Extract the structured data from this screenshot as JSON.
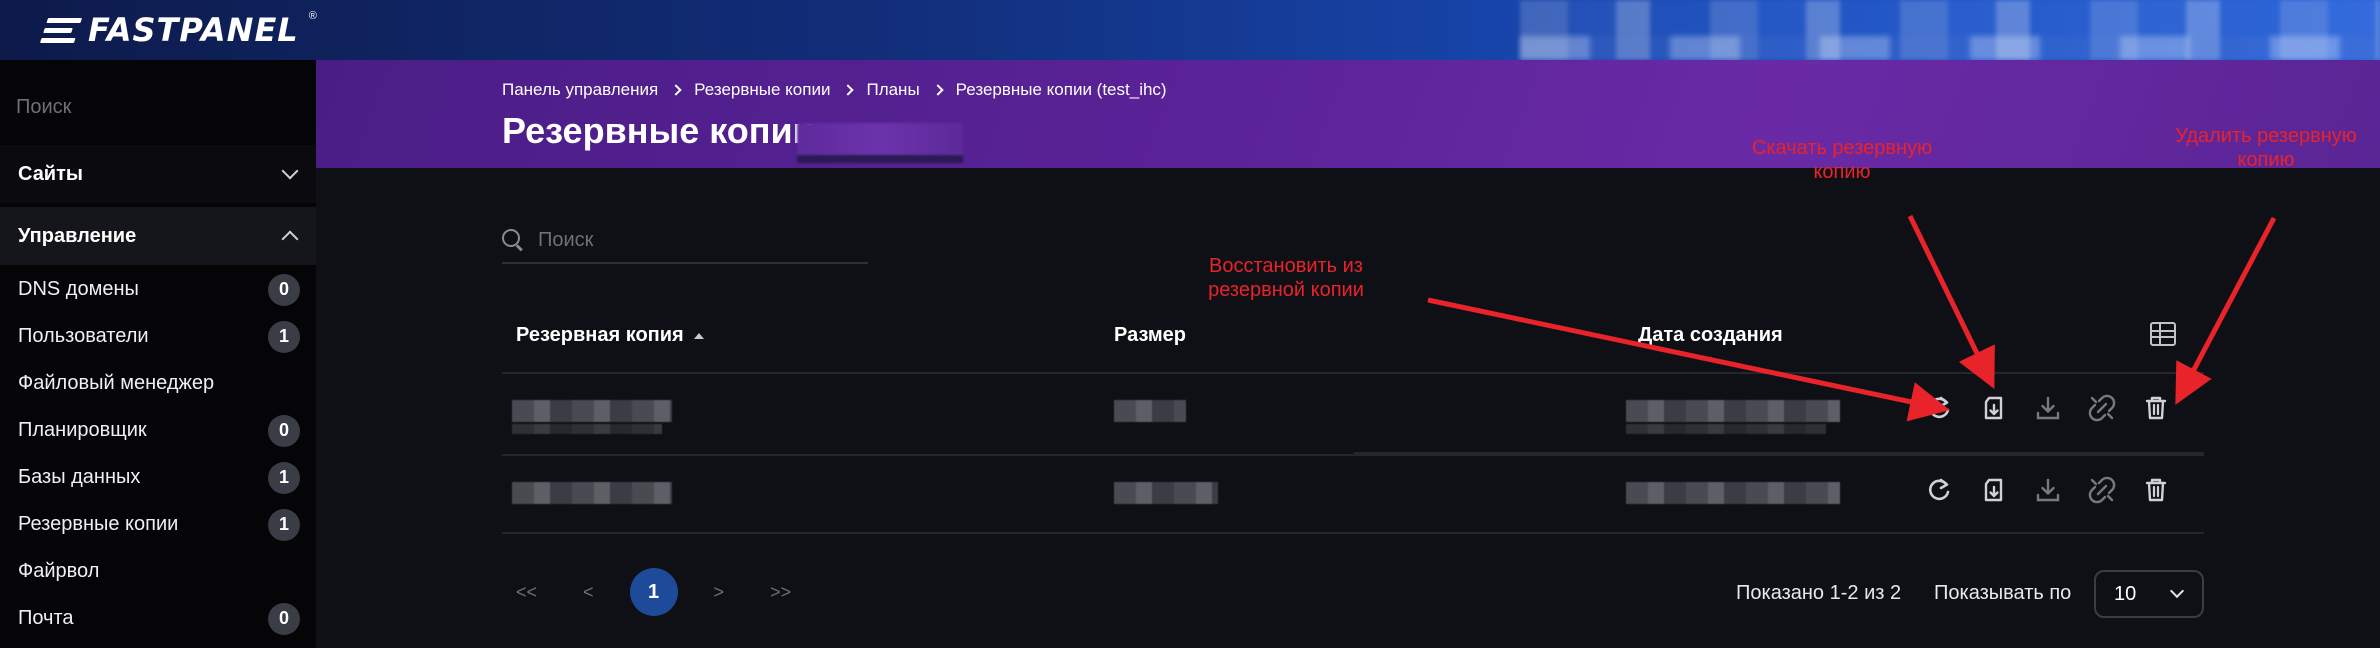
{
  "brand": {
    "name": "FASTPANEL",
    "registered": "®"
  },
  "sidebar": {
    "search_placeholder": "Поиск",
    "groups": [
      {
        "label": "Сайты",
        "state": "collapsed"
      },
      {
        "label": "Управление",
        "state": "expanded"
      }
    ],
    "items": [
      {
        "label": "DNS домены",
        "badge": "0"
      },
      {
        "label": "Пользователи",
        "badge": "1"
      },
      {
        "label": "Файловый менеджер",
        "badge": null
      },
      {
        "label": "Планировщик",
        "badge": "0"
      },
      {
        "label": "Базы данных",
        "badge": "1"
      },
      {
        "label": "Резервные копии",
        "badge": "1"
      },
      {
        "label": "Файрвол",
        "badge": null
      },
      {
        "label": "Почта",
        "badge": "0"
      }
    ]
  },
  "header": {
    "breadcrumbs": [
      "Панель управления",
      "Резервные копии",
      "Планы",
      "Резервные копии (test_ihc)"
    ],
    "title": "Резервные копии"
  },
  "main": {
    "search_placeholder": "Поиск",
    "table": {
      "columns": [
        "Резервная копия",
        "Размер",
        "Дата создания"
      ],
      "sorted_column": "Резервная копия",
      "row_count": 2,
      "row_actions": [
        "restore-icon",
        "download-to-server-icon",
        "download-icon",
        "unlink-icon",
        "trash-icon"
      ]
    },
    "pagination": {
      "first": "<<",
      "prev": "<",
      "current": "1",
      "next": ">",
      "last": ">>",
      "shown": "Показано 1-2 из 2",
      "per_page_label": "Показывать по",
      "per_page_value": "10"
    }
  },
  "annotations": {
    "restore": "Восстановить из резервной копии",
    "download": "Скачать резервную копию",
    "delete": "Удалить резервную копию",
    "color": "#e8232a"
  },
  "colors": {
    "topbar": "#12307e",
    "header": "#5b2398",
    "accent": "#1e4a9a",
    "background": "#0f1015",
    "sidebar": "#050507"
  }
}
